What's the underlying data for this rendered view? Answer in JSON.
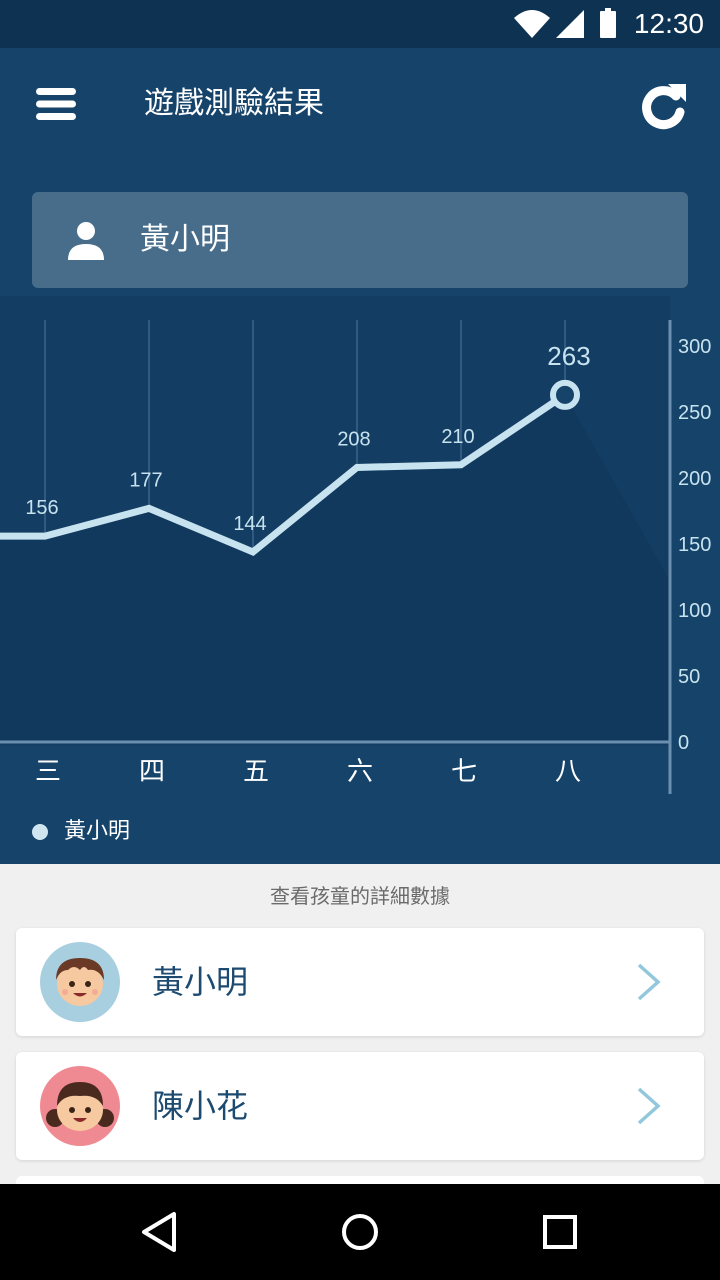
{
  "status_bar": {
    "time": "12:30"
  },
  "app_bar": {
    "title": "遊戲測驗結果",
    "menu_icon": "hamburger-menu-icon",
    "refresh_icon": "refresh-icon"
  },
  "selected_child": {
    "name": "黃小明",
    "icon": "person-icon"
  },
  "colors": {
    "panel": "#16436a",
    "status": "#0e3252",
    "line": "#c7e3ef",
    "user_box": "#486d8b"
  },
  "chart_data": {
    "type": "line",
    "categories": [
      "三",
      "四",
      "五",
      "六",
      "七",
      "八"
    ],
    "series": [
      {
        "name": "黃小明",
        "values": [
          156,
          177,
          144,
          208,
          210,
          263
        ]
      }
    ],
    "ylim": [
      0,
      300
    ],
    "yticks": [
      300,
      250,
      200,
      150,
      100,
      50,
      0
    ],
    "y_axis_position": "right",
    "highlight": {
      "category": "八",
      "value": 263
    },
    "grid": "vertical",
    "legend": "bottom-left"
  },
  "list": {
    "hint": "查看孩童的詳細數據",
    "children": [
      {
        "name": "黃小明",
        "avatar": "boy-avatar-icon"
      },
      {
        "name": "陳小花",
        "avatar": "girl-avatar-icon"
      }
    ]
  },
  "nav_bar": {
    "back": "back-icon",
    "home": "home-icon",
    "recents": "recents-icon"
  }
}
